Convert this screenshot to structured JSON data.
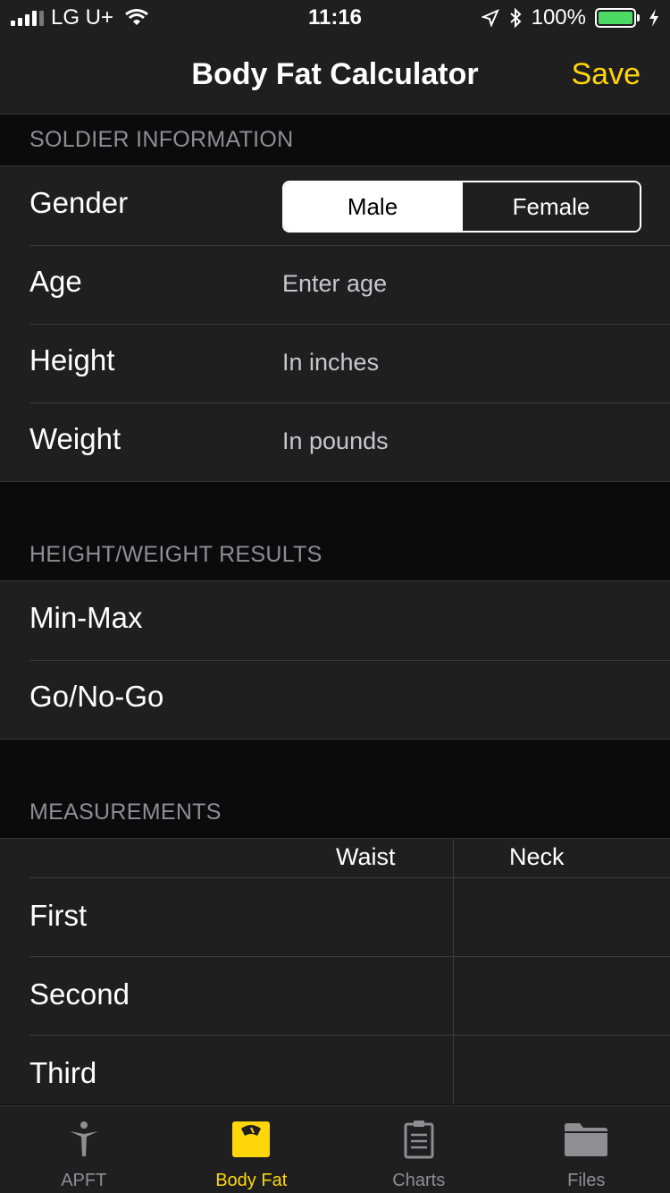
{
  "status": {
    "carrier": "LG U+",
    "time": "11:16",
    "battery_text": "100%",
    "battery_level": 1.0,
    "icons": [
      "signal-icon",
      "wifi-icon",
      "location-icon",
      "bluetooth-icon",
      "battery-icon",
      "charging-icon"
    ]
  },
  "nav": {
    "title": "Body Fat Calculator",
    "save_label": "Save",
    "accent_color": "#ffd60a"
  },
  "soldier": {
    "header": "SOLDIER INFORMATION",
    "gender_label": "Gender",
    "gender_options": [
      "Male",
      "Female"
    ],
    "gender_selected": "Male",
    "age_label": "Age",
    "age_placeholder": "Enter age",
    "height_label": "Height",
    "height_placeholder": "In inches",
    "weight_label": "Weight",
    "weight_placeholder": "In pounds"
  },
  "hw_results": {
    "header": "HEIGHT/WEIGHT RESULTS",
    "rows": [
      "Min-Max",
      "Go/No-Go"
    ]
  },
  "measurements": {
    "header": "MEASUREMENTS",
    "columns": [
      "Waist",
      "Neck"
    ],
    "rows": [
      "First",
      "Second",
      "Third"
    ]
  },
  "tabs": [
    {
      "label": "APFT",
      "icon": "figure-icon",
      "active": false
    },
    {
      "label": "Body Fat",
      "icon": "scale-icon",
      "active": true
    },
    {
      "label": "Charts",
      "icon": "clipboard-icon",
      "active": false
    },
    {
      "label": "Files",
      "icon": "folder-icon",
      "active": false
    }
  ]
}
